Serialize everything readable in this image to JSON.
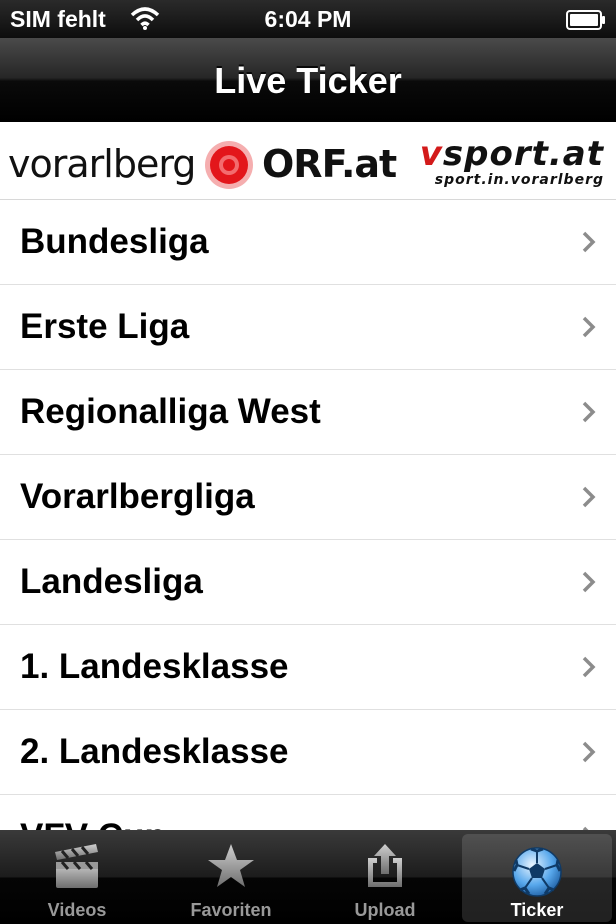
{
  "status_bar": {
    "carrier": "SIM fehlt",
    "time": "6:04 PM"
  },
  "nav": {
    "title": "Live Ticker"
  },
  "banner": {
    "orf_text_left": "vorarlberg",
    "orf_text_right": "ORF.at",
    "vsport_v": "v",
    "vsport_rest": "sport.at",
    "vsport_tagline": "sport.in.vorarlberg"
  },
  "list": {
    "items": [
      {
        "label": "Bundesliga"
      },
      {
        "label": "Erste Liga"
      },
      {
        "label": "Regionalliga West"
      },
      {
        "label": "Vorarlbergliga"
      },
      {
        "label": "Landesliga"
      },
      {
        "label": "1. Landesklasse"
      },
      {
        "label": "2. Landesklasse"
      },
      {
        "label": "VFV-Cup"
      }
    ]
  },
  "tabbar": {
    "tabs": [
      {
        "label": "Videos",
        "icon": "clapperboard-icon"
      },
      {
        "label": "Favoriten",
        "icon": "star-icon"
      },
      {
        "label": "Upload",
        "icon": "upload-icon"
      },
      {
        "label": "Ticker",
        "icon": "soccer-ball-icon",
        "active": true
      }
    ]
  },
  "colors": {
    "orf_red": "#e3161b",
    "vsport_red": "#d31a1a",
    "chevron": "#8c8c8c"
  }
}
